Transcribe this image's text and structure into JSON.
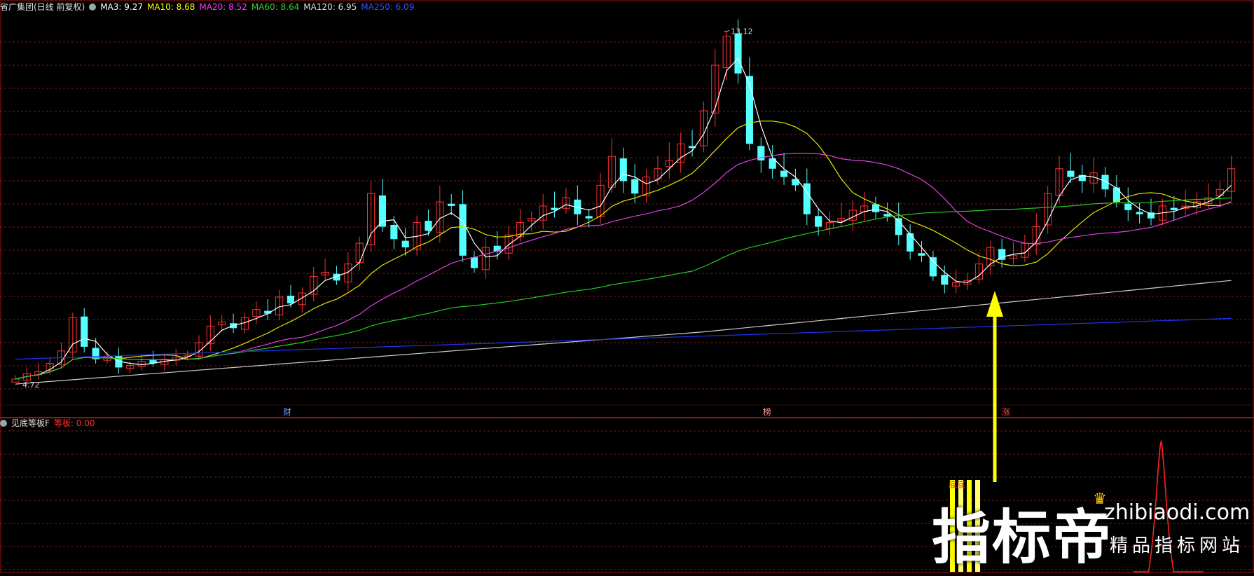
{
  "main_panel": {
    "stock_label": "省广集团(日线 前复权)",
    "ma_legend": [
      {
        "label": "MA3: 9.27",
        "color": "#ffffff"
      },
      {
        "label": "MA10: 8.68",
        "color": "#ffff00"
      },
      {
        "label": "MA20: 8.52",
        "color": "#ff33ff"
      },
      {
        "label": "MA60: 8.64",
        "color": "#33cc33"
      },
      {
        "label": "MA120: 6.95",
        "color": "#dddddd"
      },
      {
        "label": "MA250: 6.09",
        "color": "#3355ff"
      }
    ],
    "high_label": "13.12",
    "low_label": "4.72",
    "event_markers": [
      "财",
      "榜",
      "涨"
    ]
  },
  "sub_panel": {
    "indicator_name": "见底等板F",
    "value_label": "等板: 0.00",
    "bottom_label": "底底"
  },
  "watermark": {
    "brand": "指标帝",
    "domain": "zhibiaodi.com",
    "tagline": "精品指标网站"
  },
  "colors": {
    "up": "#ff3232",
    "down": "#54ffff",
    "grid": "#7a1a1a",
    "border": "#a01010",
    "arrow": "#ffff00"
  },
  "chart_data": {
    "type": "candlestick",
    "y_range": [
      4.5,
      13.4
    ],
    "sub_series": {
      "name": "等板",
      "spike_index": 100
    }
  }
}
